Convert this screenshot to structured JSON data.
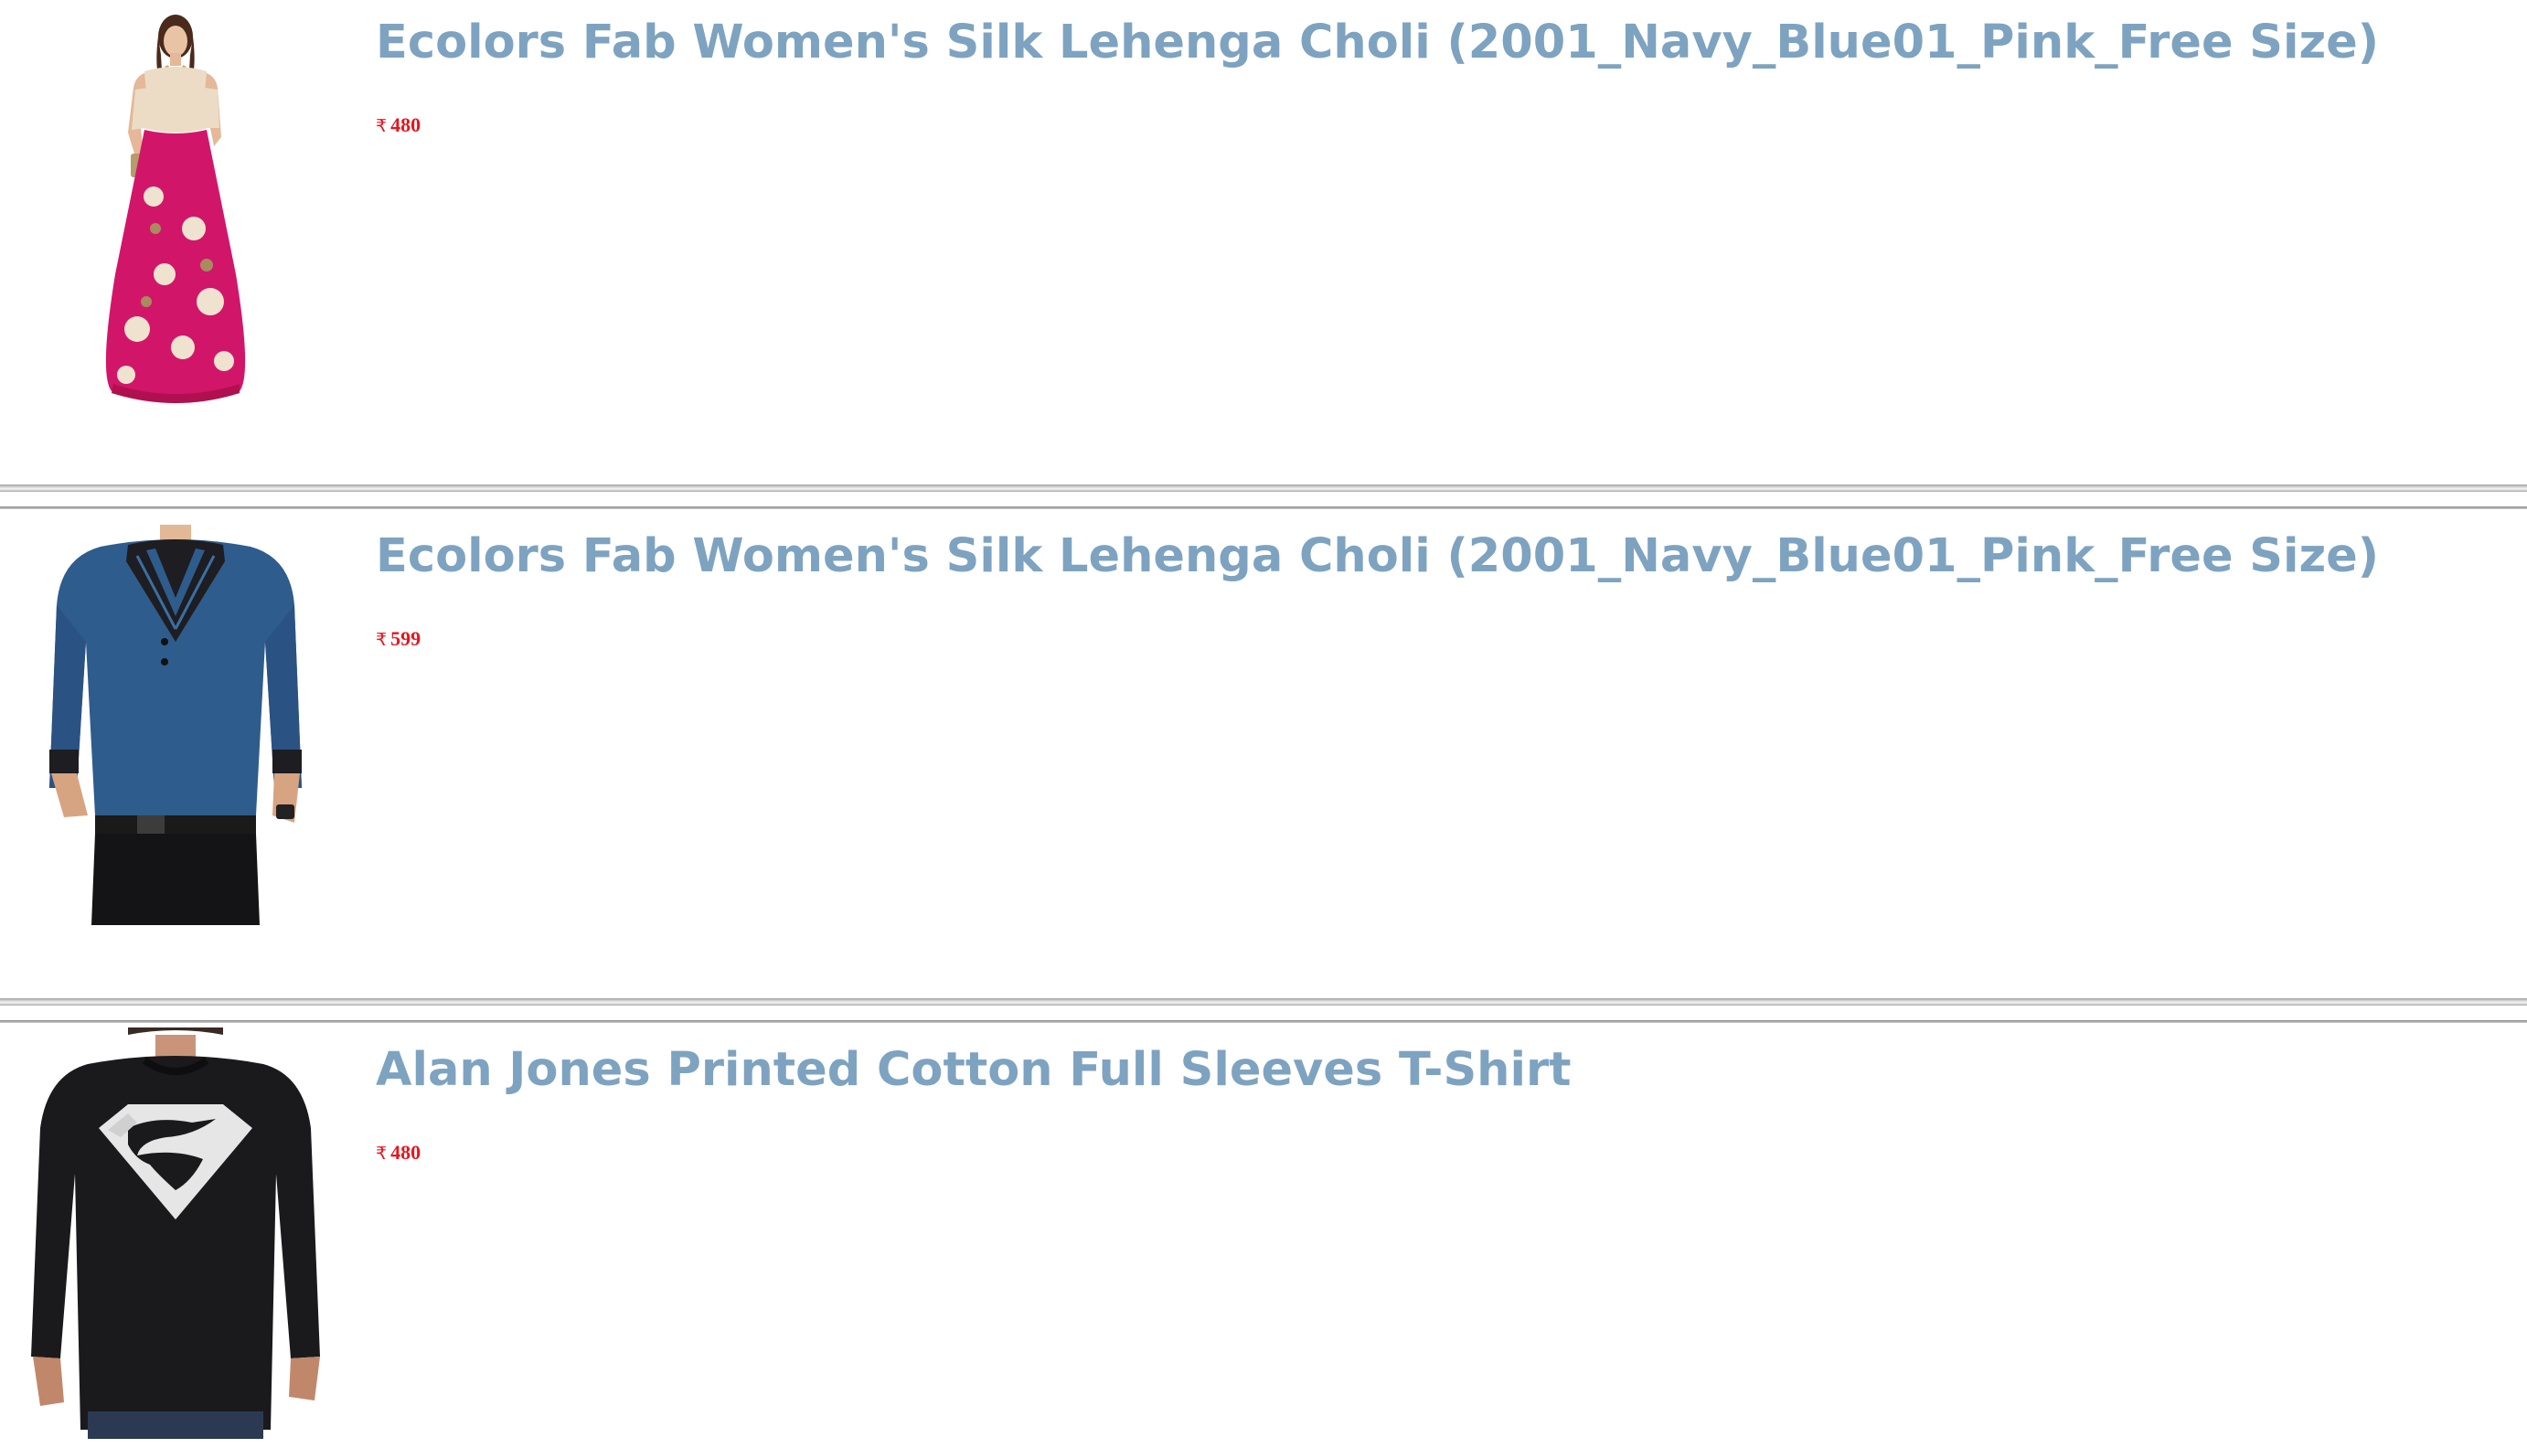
{
  "theme": {
    "title_color": "#7ea3c0",
    "price_color": "#e8141e"
  },
  "products": [
    {
      "image_icon": "lehenga-choli-image",
      "title": "Ecolors Fab Women's Silk Lehenga Choli (2001_Navy_Blue01_Pink_Free Size)",
      "currency": "₹",
      "price": "480"
    },
    {
      "image_icon": "blue-shawl-collar-tshirt-image",
      "title": "Ecolors Fab Women's Silk Lehenga Choli (2001_Navy_Blue01_Pink_Free Size)",
      "currency": "₹",
      "price": "599"
    },
    {
      "image_icon": "black-superman-tshirt-image",
      "title": "Alan Jones Printed Cotton Full Sleeves T-Shirt",
      "currency": "₹",
      "price": "480"
    }
  ]
}
